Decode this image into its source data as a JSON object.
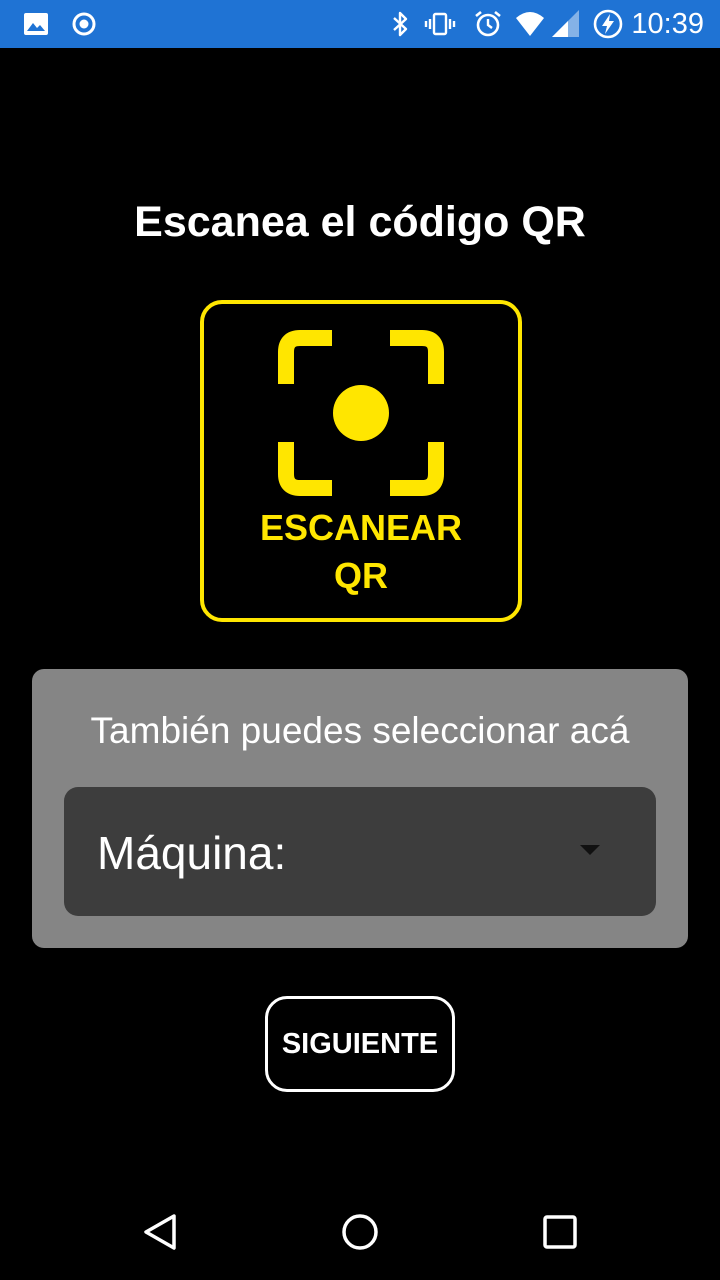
{
  "status_bar": {
    "time": "10:39",
    "background": "#1f73d4",
    "left_icons": [
      "image-icon",
      "record-icon"
    ],
    "right_icons": [
      "bluetooth-icon",
      "vibrate-icon",
      "alarm-icon",
      "wifi-icon",
      "signal-icon",
      "battery-charging-icon"
    ]
  },
  "main": {
    "title": "Escanea el código QR",
    "scan_button": {
      "label": "ESCANEAR\nQR",
      "icon": "qr-scan-icon",
      "accent_color": "#ffe600"
    },
    "select_card": {
      "hint": "También puedes seleccionar acá",
      "dropdown": {
        "label": "Máquina:",
        "icon": "dropdown-arrow-icon"
      },
      "card_color": "#858585",
      "dropdown_color": "#3d3d3d"
    },
    "next_button": {
      "label": "SIGUIENTE"
    }
  },
  "nav_bar": {
    "buttons": [
      "back-icon",
      "home-icon",
      "recents-icon"
    ]
  }
}
